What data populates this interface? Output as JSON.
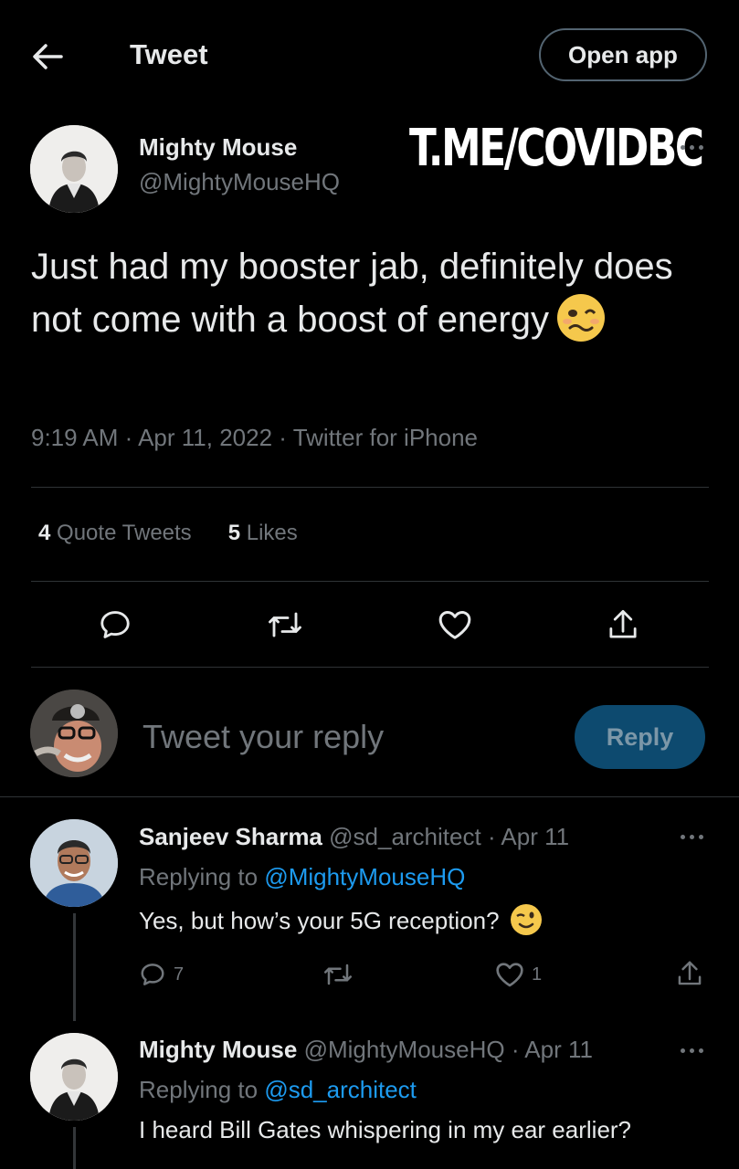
{
  "header": {
    "title": "Tweet",
    "open_app_label": "Open app"
  },
  "tweet": {
    "author_name": "Mighty Mouse",
    "author_handle": "@MightyMouseHQ",
    "watermark": "T.ME/COVIDBC",
    "text": "Just had my booster jab, definitely does not come with a boost of energy",
    "emoji": "woozy-face",
    "time": "9:19 AM",
    "date": "Apr 11, 2022",
    "source": "Twitter for iPhone",
    "quote_tweets_count": "4",
    "quote_tweets_label": "Quote Tweets",
    "likes_count": "5",
    "likes_label": "Likes"
  },
  "composer": {
    "placeholder": "Tweet your reply",
    "reply_label": "Reply"
  },
  "replies": [
    {
      "name": "Sanjeev Sharma",
      "handle": "@sd_architect",
      "date": "Apr 11",
      "replying_prefix": "Replying to",
      "replying_to": "@MightyMouseHQ",
      "text": "Yes, but how’s your 5G reception?",
      "emoji": "winking-face",
      "reply_count": "7",
      "retweet_count": "",
      "like_count": "1"
    },
    {
      "name": "Mighty Mouse",
      "handle": "@MightyMouseHQ",
      "date": "Apr 11",
      "replying_prefix": "Replying to",
      "replying_to": "@sd_architect",
      "text": "I heard Bill Gates whispering in my ear earlier?"
    }
  ],
  "colors": {
    "background": "#000000",
    "text": "#e7e9ea",
    "secondary": "#71767b",
    "link": "#1d9bf0",
    "divider": "#2f3336",
    "reply_button": "#0d4a6f"
  }
}
